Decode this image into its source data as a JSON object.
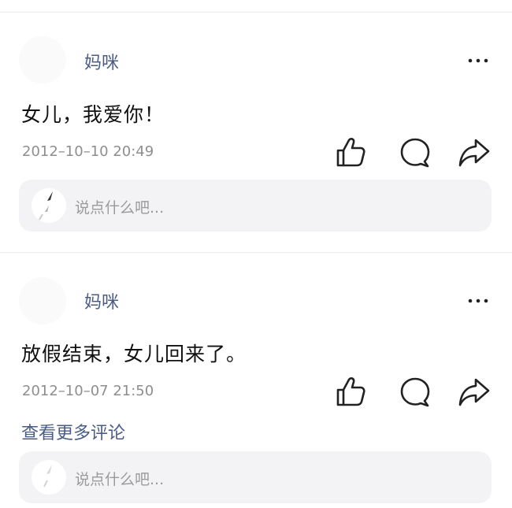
{
  "posts": [
    {
      "username": "妈咪",
      "content": "女儿，我爱你！",
      "timestamp": "2012–10–10 20:49",
      "comment_placeholder": "说点什么吧..."
    },
    {
      "username": "妈咪",
      "content": "放假结束，女儿回来了。",
      "timestamp": "2012–10–07 21:50",
      "view_more_label": "查看更多评论",
      "comment_placeholder": "说点什么吧..."
    }
  ],
  "icons": {
    "more": "more-dots-icon",
    "like": "thumbs-up-icon",
    "comment": "comment-bubble-icon",
    "share": "share-arrow-icon"
  },
  "colors": {
    "username": "#4a5c86",
    "link": "#4a5c86",
    "text": "#111111",
    "meta": "#8e8e8e",
    "input_bg": "#f3f3f5"
  }
}
